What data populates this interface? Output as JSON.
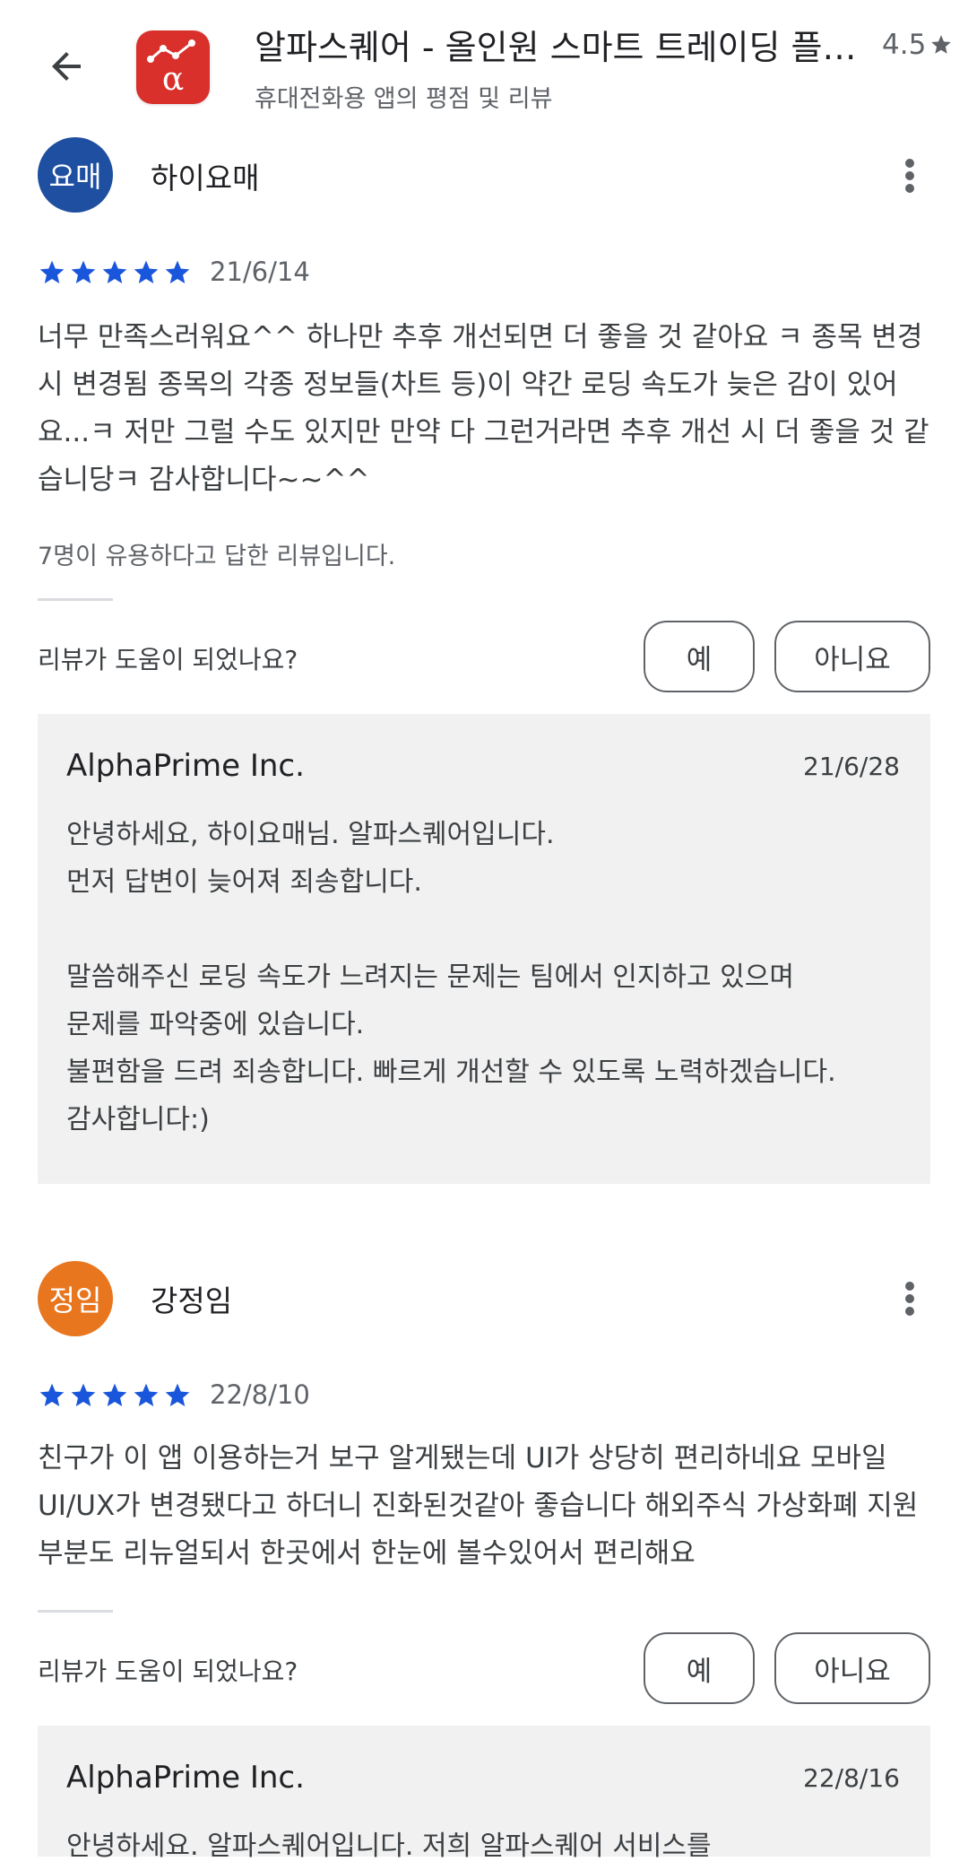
{
  "header": {
    "title": "알파스퀘어 - 올인원 스마트 트레이딩 플랫폼",
    "subtitle": "휴대전화용 앱의 평점 및 리뷰",
    "rating": "4.5",
    "app_icon_letter": "α"
  },
  "colors": {
    "star": "#1a56db",
    "avatar1": "#1f4fa0",
    "avatar2": "#e8761f",
    "app_icon": "#d9302b"
  },
  "reviews": [
    {
      "avatar_text": "요매",
      "name": "하이요매",
      "stars": 5,
      "date": "21/6/14",
      "body": "너무 만족스러워요^^ 하나만 추후 개선되면 더 좋을 것 같아요 ㅋ 종목 변경 시 변경됨 종목의 각종 정보들(차트 등)이 약간 로딩 속도가 늦은 감이 있어요...ㅋ 저만 그럴 수도 있지만 만약 다 그런거라면 추후 개선 시 더 좋을 것 같습니당ㅋ 감사합니다~~^^",
      "helpful_count": "7명이 유용하다고 답한 리뷰입니다.",
      "helpful_question": "리뷰가 도움이 되었나요?",
      "yes_label": "예",
      "no_label": "아니요",
      "reply": {
        "name": "AlphaPrime Inc.",
        "date": "21/6/28",
        "body": "안녕하세요, 하이요매님. 알파스퀘어입니다.\n먼저 답변이 늦어져 죄송합니다.\n\n말씀해주신 로딩 속도가 느려지는 문제는 팀에서 인지하고 있으며\n문제를 파악중에 있습니다.\n불편함을 드려 죄송합니다. 빠르게 개선할 수 있도록 노력하겠습니다.\n감사합니다:)"
      }
    },
    {
      "avatar_text": "정임",
      "name": "강정임",
      "stars": 5,
      "date": "22/8/10",
      "body": "친구가 이 앱 이용하는거 보구 알게됐는데 UI가 상당히 편리하네요 모바일 UI/UX가 변경됐다고 하더니 진화된것같아 좋습니다 해외주식 가상화폐 지원부분도 리뉴얼되서 한곳에서 한눈에 볼수있어서 편리해요",
      "helpful_question": "리뷰가 도움이 되었나요?",
      "yes_label": "예",
      "no_label": "아니요",
      "reply": {
        "name": "AlphaPrime Inc.",
        "date": "22/8/16",
        "body": "안녕하세요. 알파스퀘어입니다. 저희 알파스퀘어 서비스를"
      }
    }
  ]
}
